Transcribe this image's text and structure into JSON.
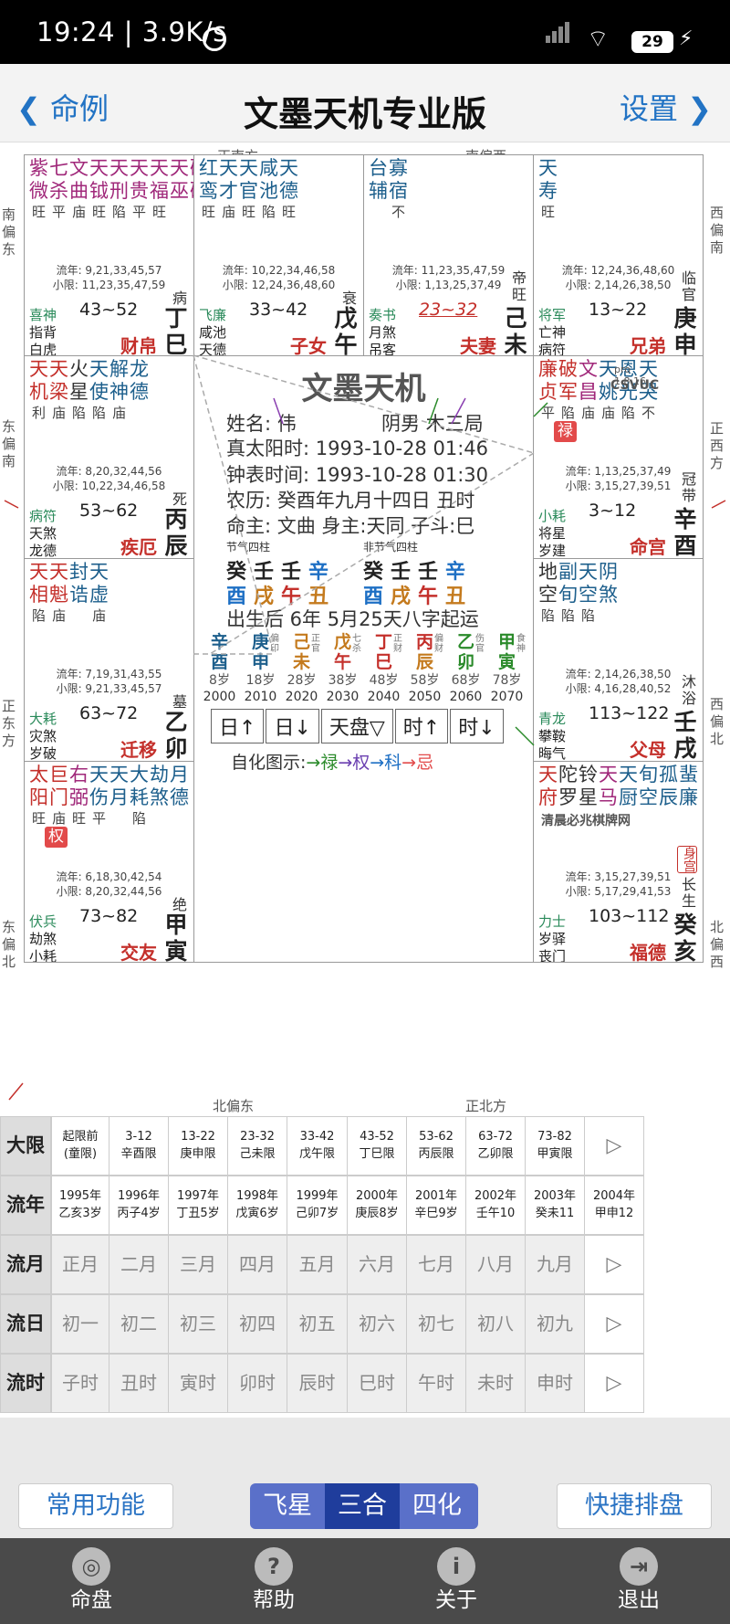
{
  "status": {
    "time": "19:24",
    "speed": "3.9K/s",
    "battery": "29"
  },
  "nav": {
    "back": "命例",
    "title": "文墨天机专业版",
    "settings": "设置"
  },
  "directions": {
    "top_left": "正南方",
    "top_right": "南偏西",
    "bottom_left": "北偏东",
    "bottom_right": "正北方",
    "left_1": "南\n偏\n东",
    "left_2": "东\n偏\n南",
    "left_3": "正\n东\n方",
    "left_4": "东\n偏\n北",
    "right_1": "西\n偏\n南",
    "right_2": "正\n西\n方",
    "right_3": "西\n偏\n北",
    "right_4": "北\n偏\n西"
  },
  "palaces": {
    "si": {
      "stars": [
        {
          "n": "紫微",
          "b": "旺",
          "c": "#a0287a"
        },
        {
          "n": "七杀",
          "b": "平",
          "c": "#a0287a"
        },
        {
          "n": "文曲",
          "b": "庙",
          "c": "#a0287a"
        },
        {
          "n": "天钺",
          "b": "旺",
          "c": "#a0287a"
        },
        {
          "n": "天刑",
          "b": "陷",
          "c": "#a0287a"
        },
        {
          "n": "天贵",
          "b": "平",
          "c": "#a0287a"
        },
        {
          "n": "天福",
          "b": "旺",
          "c": "#a0287a"
        },
        {
          "n": "天巫",
          "b": "",
          "c": "#a0287a"
        },
        {
          "n": "破碎",
          "b": "陷",
          "c": "#a0287a"
        }
      ],
      "liu1": "流年: 9,21,33,45,57",
      "liu2": "小限: 11,23,35,47,59",
      "god1": "喜神",
      "god2": "指背",
      "god3": "白虎",
      "range": "43~52",
      "stage": "病",
      "stem": "丁巳",
      "name": "财帛"
    },
    "wu": {
      "stars": [
        {
          "n": "红鸾",
          "b": "旺",
          "c": "#1d5f8c"
        },
        {
          "n": "天才",
          "b": "庙",
          "c": "#1d5f8c"
        },
        {
          "n": "天官",
          "b": "旺",
          "c": "#1d5f8c"
        },
        {
          "n": "咸池",
          "b": "陷",
          "c": "#1d5f8c"
        },
        {
          "n": "天德",
          "b": "旺",
          "c": "#1d5f8c"
        }
      ],
      "liu1": "流年: 10,22,34,46,58",
      "liu2": "小限: 12,24,36,48,60",
      "god1": "飞廉",
      "god2": "咸池",
      "god3": "天德",
      "range": "33~42",
      "stage": "衰",
      "stem": "戊午",
      "name": "子女"
    },
    "wei": {
      "stars": [
        {
          "n": "台辅",
          "b": "",
          "c": "#1d5f8c"
        },
        {
          "n": "寡宿",
          "b": "不",
          "c": "#1d5f8c"
        }
      ],
      "liu1": "流年: 11,23,35,47,59",
      "liu2": "小限: 1,13,25,37,49",
      "god1": "奏书",
      "god2": "月煞",
      "god3": "吊客",
      "range": "23~32",
      "stage": "帝旺",
      "stem": "己未",
      "name": "夫妻"
    },
    "shen": {
      "stars": [
        {
          "n": "天寿",
          "b": "旺",
          "c": "#1d5f8c"
        }
      ],
      "liu1": "流年: 12,24,36,48,60",
      "liu2": "小限: 2,14,26,38,50",
      "god1": "将军",
      "god2": "亡神",
      "god3": "病符",
      "range": "13~22",
      "stage": "临官",
      "stem": "庚申",
      "name": "兄弟"
    },
    "chen": {
      "stars": [
        {
          "n": "天机",
          "b": "利",
          "c": "#c4302b"
        },
        {
          "n": "天梁",
          "b": "庙",
          "c": "#c4302b"
        },
        {
          "n": "火星",
          "b": "陷",
          "c": "#333"
        },
        {
          "n": "天使",
          "b": "陷",
          "c": "#1d5f8c"
        },
        {
          "n": "解神",
          "b": "庙",
          "c": "#1d5f8c"
        },
        {
          "n": "龙德",
          "b": "",
          "c": "#1d5f8c"
        }
      ],
      "liu1": "流年: 8,20,32,44,56",
      "liu2": "小限: 10,22,34,46,58",
      "god1": "病符",
      "god2": "天煞",
      "god3": "龙德",
      "range": "53~62",
      "stage": "死",
      "stem": "丙辰",
      "name": "疾厄"
    },
    "you": {
      "stars": [
        {
          "n": "廉贞",
          "b": "平",
          "c": "#c4302b"
        },
        {
          "n": "破军",
          "b": "陷",
          "c": "#c4302b"
        },
        {
          "n": "文昌",
          "b": "庙",
          "c": "#a0287a"
        },
        {
          "n": "天姚",
          "b": "庙",
          "c": "#1d5f8c"
        },
        {
          "n": "恩光",
          "b": "陷",
          "c": "#1d5f8c"
        },
        {
          "n": "天哭",
          "b": "不",
          "c": "#1d5f8c"
        }
      ],
      "hua": "禄",
      "liu1": "流年: 1,13,25,37,49",
      "liu2": "小限: 3,15,27,39,51",
      "god1": "小耗",
      "god2": "将星",
      "god3": "岁建",
      "range": "3~12",
      "stage": "冠带",
      "stem": "辛酉",
      "name": "命宫"
    },
    "mao": {
      "stars": [
        {
          "n": "天相",
          "b": "陷",
          "c": "#c4302b"
        },
        {
          "n": "天魁",
          "b": "庙",
          "c": "#c4302b"
        },
        {
          "n": "封诰",
          "b": "",
          "c": "#1d5f8c"
        },
        {
          "n": "天虚",
          "b": "庙",
          "c": "#1d5f8c"
        }
      ],
      "liu1": "流年: 7,19,31,43,55",
      "liu2": "小限: 9,21,33,45,57",
      "god1": "大耗",
      "god2": "灾煞",
      "god3": "岁破",
      "range": "63~72",
      "stage": "墓",
      "stem": "乙卯",
      "name": "迁移"
    },
    "xu": {
      "stars": [
        {
          "n": "地空",
          "b": "陷",
          "c": "#333"
        },
        {
          "n": "副旬",
          "b": "陷",
          "c": "#1d5f8c"
        },
        {
          "n": "天空",
          "b": "陷",
          "c": "#1d5f8c"
        },
        {
          "n": "阴煞",
          "b": "",
          "c": "#1d5f8c"
        }
      ],
      "liu1": "流年: 2,14,26,38,50",
      "liu2": "小限: 4,16,28,40,52",
      "god1": "青龙",
      "god2": "攀鞍",
      "god3": "晦气",
      "range": "113~122",
      "stage": "沐浴",
      "stem": "壬戌",
      "name": "父母"
    },
    "yin": {
      "stars": [
        {
          "n": "太阳",
          "b": "旺",
          "c": "#c4302b"
        },
        {
          "n": "巨门",
          "b": "庙",
          "c": "#c4302b"
        },
        {
          "n": "右弼",
          "b": "旺",
          "c": "#a0287a"
        },
        {
          "n": "天伤",
          "b": "平",
          "c": "#1d5f8c"
        },
        {
          "n": "天月",
          "b": "",
          "c": "#1d5f8c"
        },
        {
          "n": "大耗",
          "b": "陷",
          "c": "#1d5f8c"
        },
        {
          "n": "劫煞",
          "b": "",
          "c": "#1d5f8c"
        },
        {
          "n": "月德",
          "b": "",
          "c": "#1d5f8c"
        }
      ],
      "hua": "权",
      "liu1": "流年: 6,18,30,42,54",
      "liu2": "小限: 8,20,32,44,56",
      "god1": "伏兵",
      "god2": "劫煞",
      "god3": "小耗",
      "range": "73~82",
      "stage": "绝",
      "stem": "甲寅",
      "name": "交友"
    },
    "chou": {
      "stars": [
        {
          "n": "武曲",
          "b": "庙",
          "c": "#c4302b"
        },
        {
          "n": "贪狼",
          "b": "庙",
          "c": "#c4302b"
        },
        {
          "n": "擎羊",
          "b": "庙",
          "c": "#333"
        }
      ],
      "small": "三八龙凤截年华\n台座池阁空解盖\n庙庙平平不得陷",
      "hua": "忌",
      "liu1": "流年: 5,17,29,41,53",
      "liu2": "小限: 7,19,31,43,55",
      "god1": "官符",
      "god2": "华盖",
      "god3": "官符",
      "range": "83~92",
      "stage": "胎",
      "stem": "乙丑",
      "name": "官禄"
    },
    "zi": {
      "stars": [
        {
          "n": "天同",
          "b": "",
          "c": "#c4302b"
        },
        {
          "n": "太阴",
          "b": "",
          "c": "#c4302b"
        },
        {
          "n": "左辅",
          "b": "",
          "c": "#a0287a"
        },
        {
          "n": "禄存",
          "b": "",
          "c": "#a0287a"
        },
        {
          "n": "地劫",
          "b": "",
          "c": "#333"
        },
        {
          "n": "天喜",
          "b": "",
          "c": "#1d5f8c"
        },
        {
          "n": "副截",
          "b": "",
          "c": "#1d5f8c"
        }
      ],
      "hua": "科",
      "liu1": "流年: 4,16,28,40,52",
      "liu2": "小限: 6,18,30,42,54",
      "god1": "博士",
      "god2": "息神",
      "god3": "贯索",
      "range": "93~102",
      "stage": "养",
      "stem": "甲子",
      "name": "田宅"
    },
    "hai": {
      "stars": [
        {
          "n": "天府",
          "b": "",
          "c": "#c4302b"
        },
        {
          "n": "陀罗",
          "b": "",
          "c": "#333"
        },
        {
          "n": "铃星",
          "b": "",
          "c": "#333"
        },
        {
          "n": "天马",
          "b": "",
          "c": "#a0287a"
        },
        {
          "n": "天厨",
          "b": "",
          "c": "#1d5f8c"
        },
        {
          "n": "旬空",
          "b": "",
          "c": "#1d5f8c"
        },
        {
          "n": "孤辰",
          "b": "",
          "c": "#1d5f8c"
        },
        {
          "n": "蜚廉",
          "b": "",
          "c": "#1d5f8c"
        }
      ],
      "watermark": "清晨必兆棋牌网",
      "body": "身宫",
      "liu1": "流年: 3,15,27,39,51",
      "liu2": "小限: 5,17,29,41,53",
      "god1": "力士",
      "god2": "岁驿",
      "god3": "丧门",
      "range": "103~112",
      "stage": "长生",
      "stem": "癸亥",
      "name": "福德"
    }
  },
  "center": {
    "title": "文墨天机",
    "ver1": "pro 1.8.16",
    "ver2": "CSVUC",
    "name": "姓名: 伟",
    "gender": "阴男 木三局",
    "solar": "真太阳时: 1993-10-28 01:46",
    "clock": "钟表时间: 1993-10-28 01:30",
    "lunar": "农历: 癸酉年九月十四日 丑时",
    "ming": "命主: 文曲 身主:天同 子斗:巳",
    "p1_head": "节气四柱",
    "p2_head": "非节气四柱",
    "stems": [
      "癸",
      "壬",
      "壬",
      "辛"
    ],
    "branches": [
      "酉",
      "戌",
      "午",
      "丑"
    ],
    "qiyun": "出生后 6年 5月25天八字起运",
    "dayun": [
      {
        "s": "辛",
        "b": "酉",
        "sc": "#1d5f8c",
        "bc": "#1d5f8c",
        "t": "",
        "age": "8岁",
        "yr": "2000"
      },
      {
        "s": "庚",
        "b": "申",
        "sc": "#1d5f8c",
        "bc": "#1d5f8c",
        "t": "偏印",
        "age": "18岁",
        "yr": "2010"
      },
      {
        "s": "己",
        "b": "未",
        "sc": "#c47a1d",
        "bc": "#c47a1d",
        "t": "正官",
        "age": "28岁",
        "yr": "2020"
      },
      {
        "s": "戊",
        "b": "午",
        "sc": "#c47a1d",
        "bc": "#c4302b",
        "t": "七杀",
        "age": "38岁",
        "yr": "2030"
      },
      {
        "s": "丁",
        "b": "巳",
        "sc": "#c4302b",
        "bc": "#c4302b",
        "t": "正财",
        "age": "48岁",
        "yr": "2040"
      },
      {
        "s": "丙",
        "b": "辰",
        "sc": "#c4302b",
        "bc": "#c47a1d",
        "t": "偏财",
        "age": "58岁",
        "yr": "2050"
      },
      {
        "s": "乙",
        "b": "卯",
        "sc": "#2a8a2a",
        "bc": "#2a8a2a",
        "t": "伤官",
        "age": "68岁",
        "yr": "2060"
      },
      {
        "s": "甲",
        "b": "寅",
        "sc": "#2a8a2a",
        "bc": "#2a8a2a",
        "t": "食神",
        "age": "78岁",
        "yr": "2070"
      }
    ],
    "buttons": [
      "日↑",
      "日↓",
      "天盘▽",
      "时↑",
      "时↓"
    ],
    "legend_label": "自化图示:",
    "legend": [
      {
        "t": "→禄",
        "c": "#2a8a2a"
      },
      {
        "t": "→权",
        "c": "#6a3fb0"
      },
      {
        "t": "→科",
        "c": "#1d6fc4"
      },
      {
        "t": "→忌",
        "c": "#e24a4a"
      }
    ]
  },
  "table": {
    "rows": [
      "大限",
      "流年",
      "流月",
      "流日",
      "流时"
    ],
    "daxian": [
      "起限前\n(童限)",
      "3-12\n辛酉限",
      "13-22\n庚申限",
      "23-32\n己未限",
      "33-42\n戊午限",
      "43-52\n丁巳限",
      "53-62\n丙辰限",
      "63-72\n乙卯限",
      "73-82\n甲寅限"
    ],
    "liunian": [
      "1995年\n乙亥3岁",
      "1996年\n丙子4岁",
      "1997年\n丁丑5岁",
      "1998年\n戊寅6岁",
      "1999年\n己卯7岁",
      "2000年\n庚辰8岁",
      "2001年\n辛巳9岁",
      "2002年\n壬午10",
      "2003年\n癸未11",
      "2004年\n甲申12"
    ],
    "liuyue": [
      "正月",
      "二月",
      "三月",
      "四月",
      "五月",
      "六月",
      "七月",
      "八月",
      "九月"
    ],
    "liuri": [
      "初一",
      "初二",
      "初三",
      "初四",
      "初五",
      "初六",
      "初七",
      "初八",
      "初九"
    ],
    "liushi": [
      "子时",
      "丑时",
      "寅时",
      "卯时",
      "辰时",
      "巳时",
      "午时",
      "未时",
      "申时"
    ],
    "arrow": "▷"
  },
  "actions": {
    "common": "常用功能",
    "seg": [
      "飞星",
      "三合",
      "四化"
    ],
    "quick": "快捷排盘"
  },
  "tabs": [
    {
      "label": "命盘",
      "icon": "◎"
    },
    {
      "label": "帮助",
      "icon": "?"
    },
    {
      "label": "关于",
      "icon": "i"
    },
    {
      "label": "退出",
      "icon": "⇥"
    }
  ]
}
